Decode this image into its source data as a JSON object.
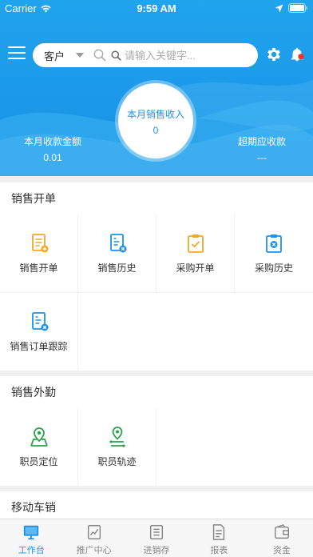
{
  "status_bar": {
    "carrier": "Carrier",
    "time": "9:59 AM"
  },
  "search": {
    "type_label": "客户",
    "placeholder": "请输入关键字..."
  },
  "summary": {
    "center_label": "本月销售收入",
    "center_value": "0",
    "left_label": "本月收款金额",
    "left_value": "0.01",
    "right_label": "超期应收款",
    "right_value": "---"
  },
  "sections": {
    "sales_order": {
      "title": "销售开单",
      "items": [
        {
          "label": "销售开单",
          "icon": "doc-add-icon",
          "color": "#f5a623"
        },
        {
          "label": "销售历史",
          "icon": "doc-history-icon",
          "color": "#1b94e6"
        },
        {
          "label": "采购开单",
          "icon": "clipboard-check-icon",
          "color": "#f5a623"
        },
        {
          "label": "采购历史",
          "icon": "clipboard-history-icon",
          "color": "#1b94e6"
        },
        {
          "label": "销售订单跟踪",
          "icon": "doc-track-icon",
          "color": "#1b94e6"
        }
      ]
    },
    "field_sales": {
      "title": "销售外勤",
      "items": [
        {
          "label": "职员定位",
          "icon": "map-pin-icon",
          "color": "#2aa34a"
        },
        {
          "label": "职员轨迹",
          "icon": "track-icon",
          "color": "#2aa34a"
        }
      ]
    },
    "mobile_sales": {
      "title": "移动车销"
    }
  },
  "tabs": [
    {
      "label": "工作台",
      "icon": "monitor-icon",
      "active": true
    },
    {
      "label": "推广中心",
      "icon": "chart-icon",
      "active": false
    },
    {
      "label": "进销存",
      "icon": "list-icon",
      "active": false
    },
    {
      "label": "报表",
      "icon": "report-icon",
      "active": false
    },
    {
      "label": "资金",
      "icon": "wallet-icon",
      "active": false
    }
  ],
  "colors": {
    "primary": "#1b94e6",
    "orange": "#f5a623",
    "green": "#2aa34a",
    "badge": "#e8372c"
  }
}
